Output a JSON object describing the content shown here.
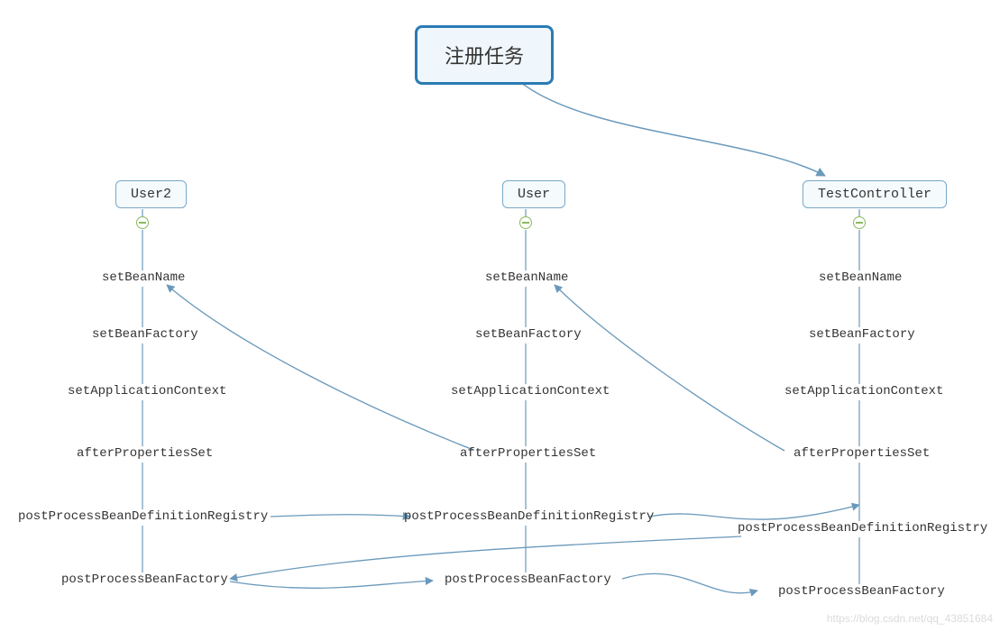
{
  "root": {
    "label": "注册任务"
  },
  "columns": [
    {
      "title": "User2",
      "items": [
        "setBeanName",
        "setBeanFactory",
        "setApplicationContext",
        "afterPropertiesSet",
        "postProcessBeanDefinitionRegistry",
        "postProcessBeanFactory"
      ]
    },
    {
      "title": "User",
      "items": [
        "setBeanName",
        "setBeanFactory",
        "setApplicationContext",
        "afterPropertiesSet",
        "postProcessBeanDefinitionRegistry",
        "postProcessBeanFactory"
      ]
    },
    {
      "title": "TestController",
      "items": [
        "setBeanName",
        "setBeanFactory",
        "setApplicationContext",
        "afterPropertiesSet",
        "postProcessBeanDefinitionRegistry",
        "postProcessBeanFactory"
      ]
    }
  ],
  "watermark": "https://blog.csdn.net/qq_43851684",
  "colors": {
    "stroke": "#6a99bb",
    "rootBorder": "#2a7bb5"
  }
}
